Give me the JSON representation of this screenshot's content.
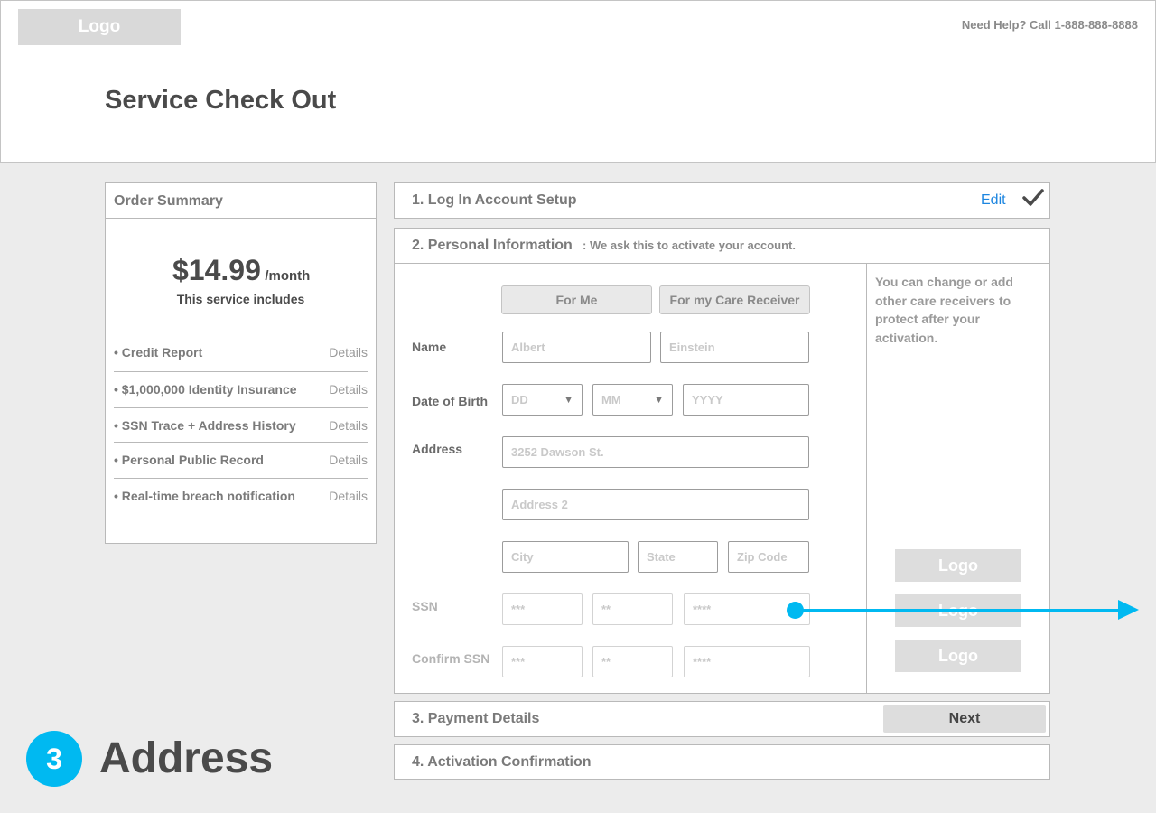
{
  "header": {
    "logo": "Logo",
    "help": "Need Help? Call 1-888-888-8888"
  },
  "page": {
    "title": "Service Check Out"
  },
  "summary": {
    "title": "Order Summary",
    "price": "$14.99",
    "unit": "/month",
    "includes": "This service includes",
    "items": [
      {
        "label": "• Credit Report",
        "details": "Details"
      },
      {
        "label": "• $1,000,000 Identity Insurance",
        "details": "Details"
      },
      {
        "label": "• SSN Trace + Address History",
        "details": "Details"
      },
      {
        "label": "• Personal Public Record",
        "details": "Details"
      },
      {
        "label": "• Real-time breach notification",
        "details": "Details"
      }
    ]
  },
  "steps": {
    "step1": {
      "title": "1. Log In Account Setup",
      "edit": "Edit",
      "check_icon": "checkmark-icon"
    },
    "step2": {
      "title": "2. Personal Information",
      "note": ": We ask this to activate your account."
    },
    "step3": {
      "title": "3. Payment Details",
      "next": "Next"
    },
    "step4": {
      "title": "4. Activation Confirmation"
    }
  },
  "form": {
    "toggle": {
      "for_me": "For Me",
      "for_care": "For my Care Receiver"
    },
    "labels": {
      "name": "Name",
      "dob": "Date of Birth",
      "address": "Address",
      "ssn": "SSN",
      "confirm_ssn": "Confirm SSN"
    },
    "placeholders": {
      "first": "Albert",
      "last": "Einstein",
      "dd": "DD",
      "mm": "MM",
      "yyyy": "YYYY",
      "address1": "3252 Dawson St.",
      "address2": "Address 2",
      "city": "City",
      "state": "State",
      "zip": "Zip Code",
      "ssn1": "***",
      "ssn2": "**",
      "ssn3": "****"
    }
  },
  "side": {
    "note": "You can change or add other care receivers to protect after your activation.",
    "logos": [
      "Logo",
      "Logo",
      "Logo"
    ]
  },
  "annotation": {
    "number": "3",
    "label": "Address",
    "color": "#00b9f1"
  },
  "colors": {
    "accent": "#00b9f1",
    "link": "#1d86e0"
  }
}
